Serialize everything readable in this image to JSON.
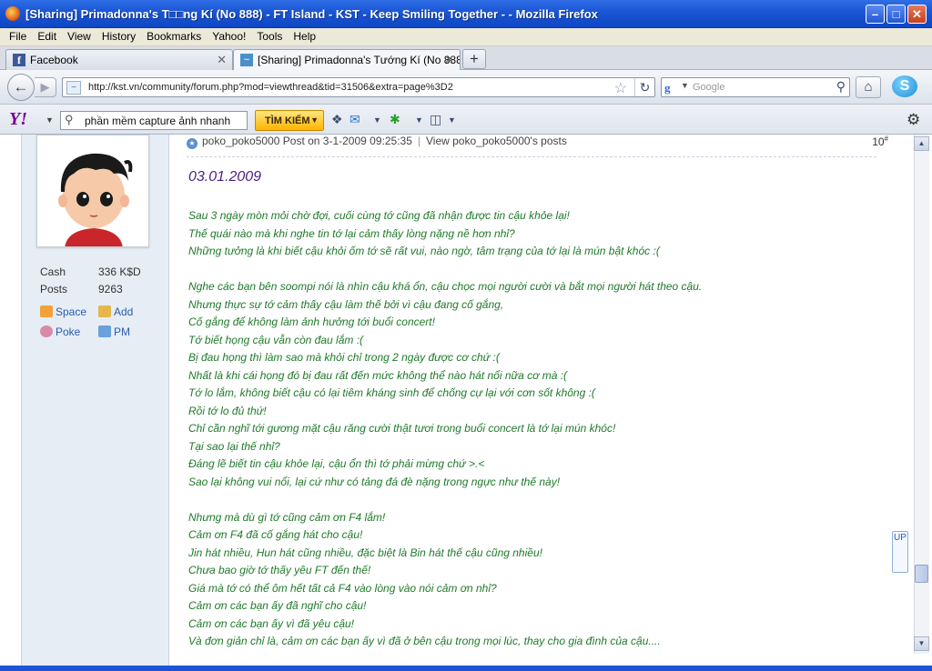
{
  "window": {
    "title": "[Sharing] Primadonna's T□□ng Kí (No 888) - FT Island - KST - Keep Smiling Together - - Mozilla Firefox",
    "min_label": "–",
    "max_label": "□",
    "close_label": "✕"
  },
  "menu": [
    "File",
    "Edit",
    "View",
    "History",
    "Bookmarks",
    "Yahoo!",
    "Tools",
    "Help"
  ],
  "tabs": [
    {
      "label": "Facebook",
      "close": "✕"
    },
    {
      "label": "[Sharing] Primadonna's Tướng Kí (No 888...",
      "close": "✕"
    }
  ],
  "newtab_label": "+",
  "nav": {
    "url": "http://kst.vn/community/forum.php?mod=viewthread&tid=31506&extra=page%3D2",
    "search_placeholder": "Google"
  },
  "yahoo_toolbar": {
    "search_value": "phần mềm capture ảnh nhanh",
    "search_button": "TÌM KIẾM"
  },
  "sidebar": {
    "stats": [
      {
        "label": "Cash",
        "value": "336 K$D"
      },
      {
        "label": "Posts",
        "value": "9263"
      }
    ],
    "actions": {
      "space": "Space",
      "add": "Add",
      "poke": "Poke",
      "pm": "PM"
    }
  },
  "post": {
    "author": "poko_poko5000",
    "posted": "Post on 3-1-2009 09:25:35",
    "view_posts": "View poko_poko5000's posts",
    "floor": "10",
    "floor_suffix": "#",
    "date": "03.01.2009",
    "lines": [
      "Sau 3 ngày mòn mỏi chờ đợi, cuối cùng tớ cũng đã nhận được tin cậu khỏe lại!",
      "Thế quái nào mà khi nghe tin tớ lại cảm thấy lòng nặng nề hơn nhỉ?",
      "Những tưởng là khi biết cậu khỏi ốm tớ sẽ rất vui, nào ngờ, tâm trạng của tớ lại là mún bật khóc :(",
      "",
      "Nghe các bạn bên soompi nói là nhìn cậu khá ổn, cậu chọc mọi người cười và bắt mọi người hát theo cậu.",
      "Nhưng thực sự tớ cảm thấy cậu làm thế bởi vì cậu đang cố gắng,",
      "Cố gắng để không làm ảnh hưởng tới buổi concert!",
      "Tớ biết họng cậu vẫn còn đau lắm :(",
      "Bị đau họng thì làm sao mà khỏi chỉ trong 2 ngày được cơ chứ :(",
      "Nhất là khi cái họng đó bị đau rất đến mức không thể nào hát nổi nữa cơ mà :(",
      "Tớ lo lắm, không biết cậu có lại tiêm kháng sinh để chống cự lại với cơn sốt không :(",
      "Rồi tớ lo đủ thứ!",
      "Chỉ cần nghĩ tới gương mặt cậu răng cười thật tươi trong buổi concert là tớ lại mún khóc!",
      "Tại sao lại thế nhỉ?",
      "Đáng lẽ biết tin cậu khỏe lại, cậu ổn thì tớ phải mừng chứ >.<",
      "Sao lại không vui nổi, lại cứ như có tảng đá đè nặng trong ngực như thế này!",
      "",
      "Nhưng mà dù gì tớ cũng cảm ơn F4 lắm!",
      "Cảm ơn F4 đã cố gắng hát cho cậu!",
      "Jin hát nhiều, Hun hát cũng nhiều, đặc biệt là Bin hát thế cậu cũng nhiều!",
      "Chưa bao giờ tớ thấy yêu FT đến thế!",
      "Giá mà tớ có thể ôm hết tất cả F4 vào lòng vào nói cảm ơn nhỉ?",
      "Cảm ơn các bạn ấy đã nghĩ cho cậu!",
      "Cảm ơn các bạn ấy vì đã yêu cậu!",
      "Và đơn giản chỉ là, cảm ơn các bạn ấy vì đã ở bên cậu trong mọi lúc, thay cho gia đình của cậu...."
    ]
  },
  "up_button": "UP",
  "icons": {
    "back": "back-arrow-icon",
    "forward": "forward-arrow-icon",
    "star": "bookmark-star-icon",
    "reload": "reload-icon",
    "home": "home-icon",
    "search": "magnifier-icon",
    "gear": "gear-icon"
  }
}
